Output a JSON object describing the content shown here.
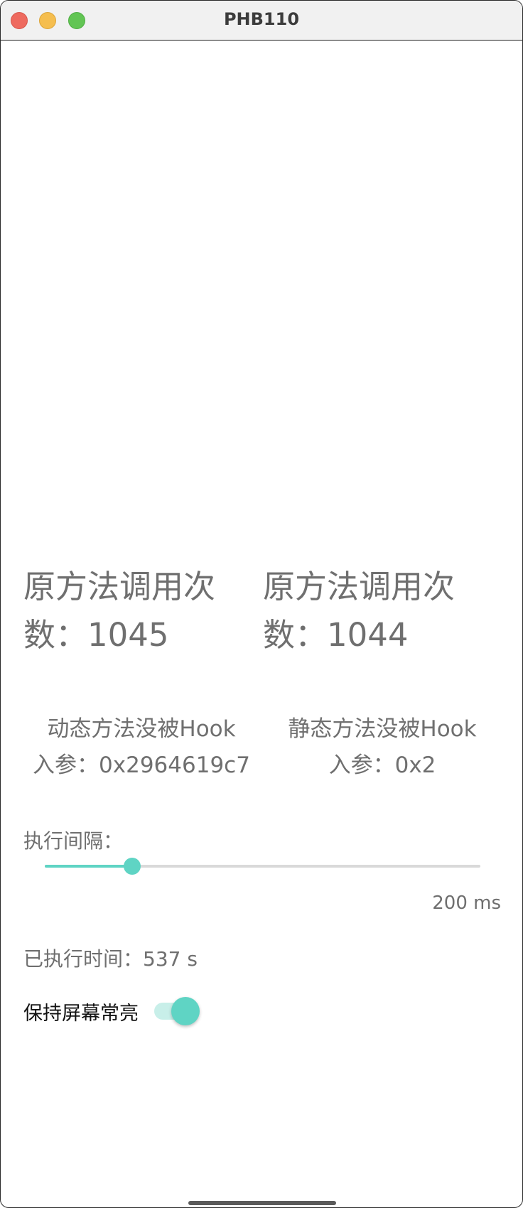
{
  "window": {
    "title": "PHB110"
  },
  "counters": {
    "dynamic": {
      "line1": "原方法调用次",
      "line2": "数：1045"
    },
    "static": {
      "line1": "原方法调用次",
      "line2": "数：1044"
    }
  },
  "status": {
    "dynamic": {
      "hook_text": "动态方法没被Hook",
      "param_text": "入参：0x2964619c7"
    },
    "static": {
      "hook_text": "静态方法没被Hook",
      "param_text": "入参：0x2"
    }
  },
  "interval": {
    "label": "执行间隔：",
    "value_text": "200 ms",
    "slider_fraction": 0.2
  },
  "elapsed": {
    "text": "已执行时间：537 s"
  },
  "keep_awake": {
    "label": "保持屏幕常亮",
    "on": true
  },
  "colors": {
    "accent": "#5fd4c4",
    "accent_light": "#c8efe9",
    "text_gray": "#6f6f6f",
    "track_gray": "#d9d9d9"
  }
}
